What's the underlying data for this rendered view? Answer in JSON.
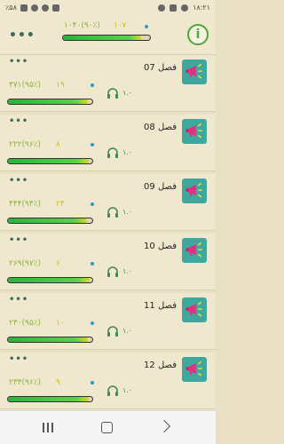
{
  "status_bar": {
    "time": "۱۸:۲۱",
    "battery": "٪۵۸"
  },
  "header": {
    "total": "۱۰۴۰(۹۰٪)",
    "small": "۱۰۷",
    "progress": 0.9
  },
  "chapters": [
    {
      "title": "فصل 07",
      "total": "۳۷۱(۹۵٪)",
      "small": "۱۹",
      "audio": "۱.۰",
      "progress": 0.95
    },
    {
      "title": "فصل 08",
      "total": "۲۲۲(۹۶٪)",
      "small": "۸",
      "audio": "۱.۰",
      "progress": 0.96
    },
    {
      "title": "فصل 09",
      "total": "۴۴۴(۹۴٪)",
      "small": "۲۴",
      "audio": "۱.۰",
      "progress": 0.94
    },
    {
      "title": "فصل 10",
      "total": "۲۶۹(۹۷٪)",
      "small": "۶",
      "audio": "۱.۰",
      "progress": 0.97
    },
    {
      "title": "فصل 11",
      "total": "۲۳۰(۹۵٪)",
      "small": "۱۰",
      "audio": "۱.۰",
      "progress": 0.95
    },
    {
      "title": "فصل 12",
      "total": "۲۳۳(۹۶٪)",
      "small": "۹",
      "audio": "۱.۰",
      "progress": 0.96
    }
  ],
  "icons": {
    "chapter": "megaphone-icon",
    "audio": "headphones-icon",
    "menu": "more-dots-icon",
    "info": "info-icon"
  },
  "colors": {
    "accent": "#4aa83a",
    "teal": "#3fa89e",
    "bar_fill": "#28b43c",
    "yellow": "#c9c01c",
    "blue_dot": "#2c9bc9"
  }
}
